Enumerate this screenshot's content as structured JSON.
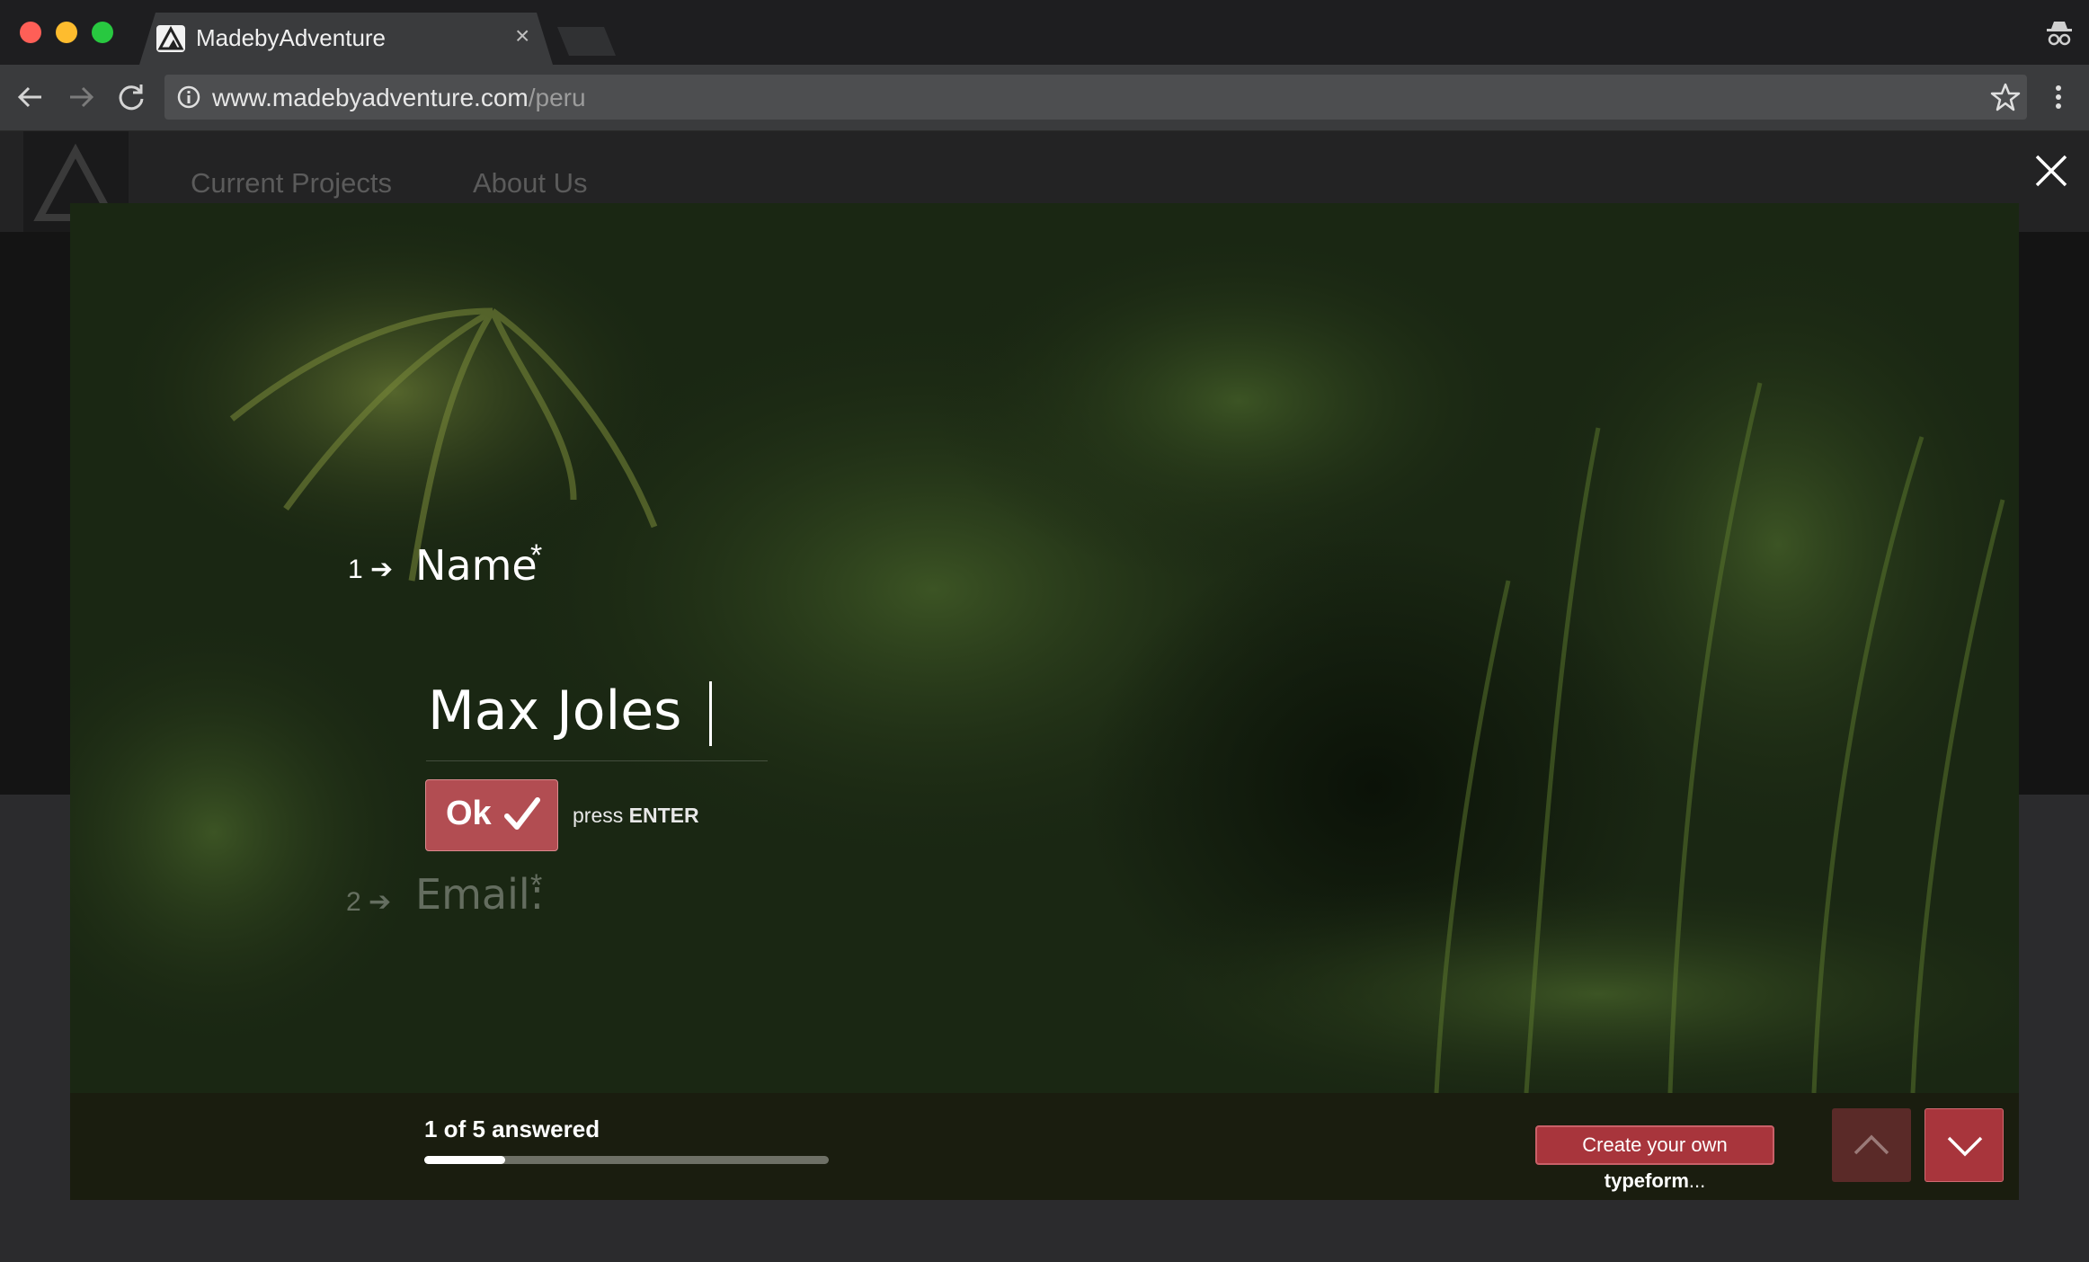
{
  "browser": {
    "tab_title": "MadebyAdventure",
    "tab_close": "×",
    "url_domain": "www.madebyadventure.com",
    "url_path": "/peru",
    "traffic_colors": [
      "#fe5f57",
      "#febc2e",
      "#28c840"
    ]
  },
  "site": {
    "nav": [
      "Current Projects",
      "About Us"
    ]
  },
  "form": {
    "question1": {
      "number": "1",
      "arrow": "➔",
      "label": "Name",
      "required": "*"
    },
    "answer_value": "Max Joles",
    "ok_label": "Ok",
    "press_prefix": "press ",
    "press_key": "ENTER",
    "question2": {
      "number": "2",
      "arrow": "➔",
      "label": "Email:",
      "required": "*"
    }
  },
  "footer": {
    "answered_text": "1 of 5 answered",
    "progress_fraction": 0.2,
    "create_prefix": "Create your own ",
    "create_brand": "typeform",
    "create_suffix": "..."
  },
  "colors": {
    "accent": "#b24d52",
    "button_red": "#a8353c"
  }
}
